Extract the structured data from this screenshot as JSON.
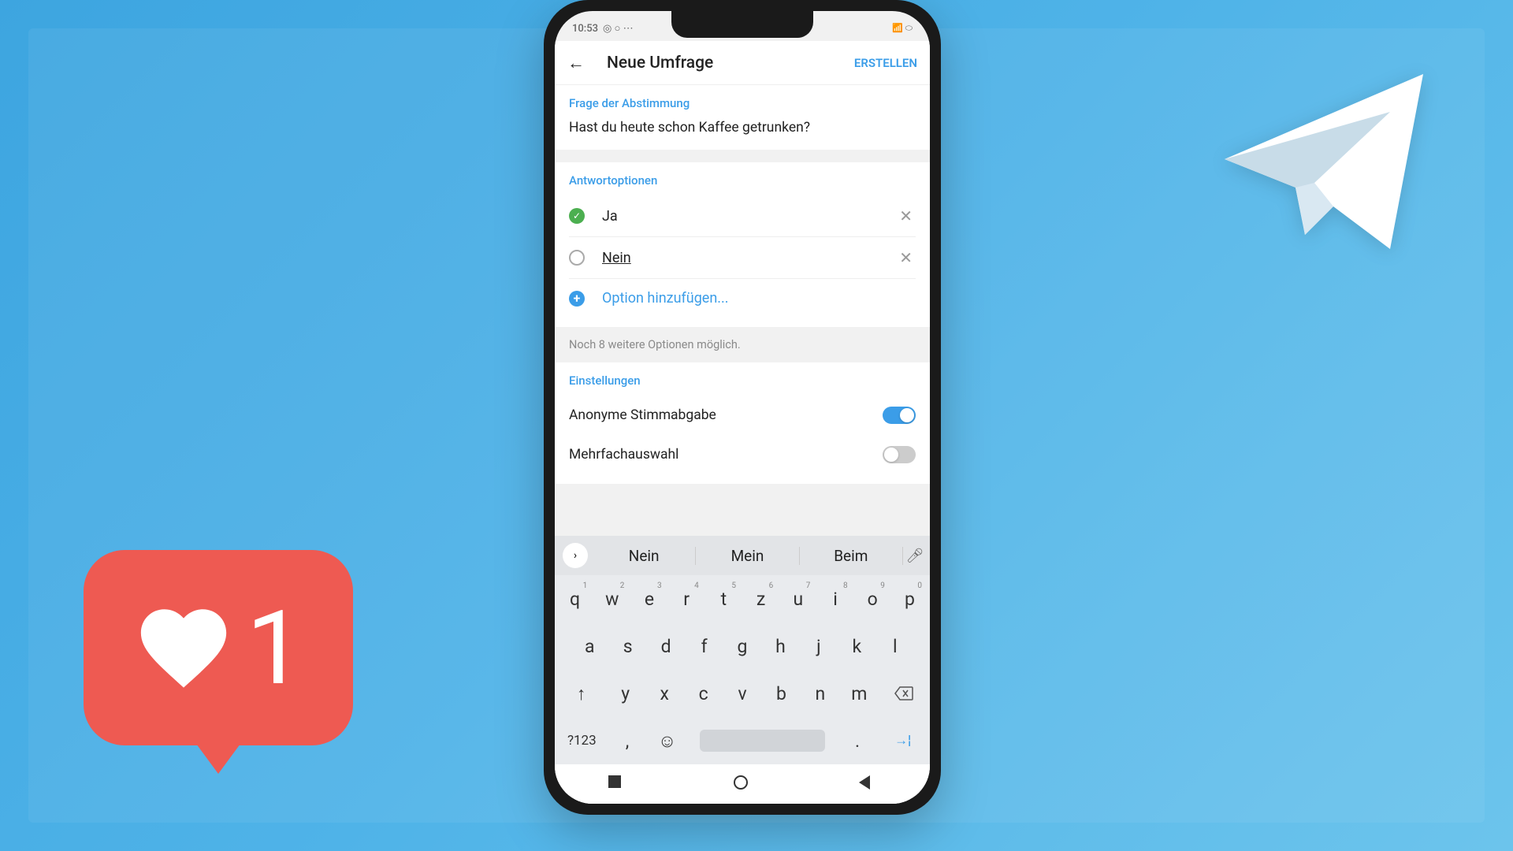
{
  "status": {
    "time": "10:53"
  },
  "header": {
    "title": "Neue Umfrage",
    "create": "ERSTELLEN"
  },
  "question": {
    "label": "Frage der Abstimmung",
    "text": "Hast du heute schon Kaffee getrunken?"
  },
  "answers": {
    "label": "Antwortoptionen",
    "opt1": "Ja",
    "opt2": "Nein",
    "add": "Option hinzufügen...",
    "hint": "Noch 8 weitere Optionen möglich."
  },
  "settings": {
    "label": "Einstellungen",
    "anonymous": "Anonyme Stimmabgabe",
    "multi": "Mehrfachauswahl"
  },
  "keyboard": {
    "sug1": "Nein",
    "sug2": "Mein",
    "sug3": "Beim",
    "row1": [
      "q",
      "w",
      "e",
      "r",
      "t",
      "z",
      "u",
      "i",
      "o",
      "p"
    ],
    "nums": [
      "1",
      "2",
      "3",
      "4",
      "5",
      "6",
      "7",
      "8",
      "9",
      "0"
    ],
    "row2": [
      "a",
      "s",
      "d",
      "f",
      "g",
      "h",
      "j",
      "k",
      "l"
    ],
    "row3": [
      "y",
      "x",
      "c",
      "v",
      "b",
      "n",
      "m"
    ],
    "numkey": "?123"
  },
  "like": {
    "count": "1"
  }
}
